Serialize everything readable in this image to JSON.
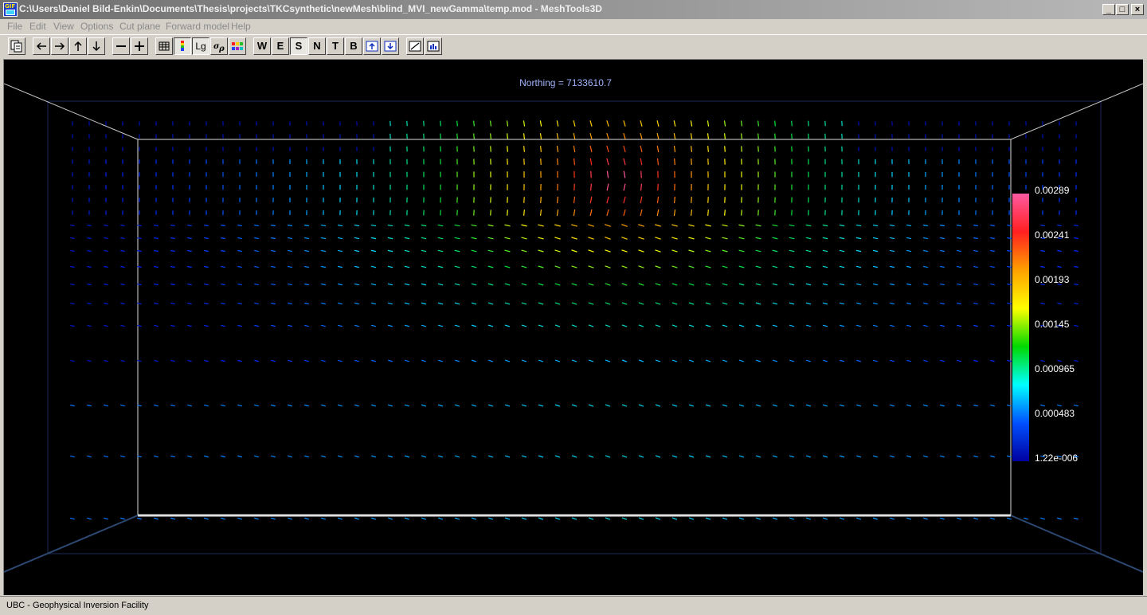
{
  "window": {
    "title": "C:\\Users\\Daniel Bild-Enkin\\Documents\\Thesis\\projects\\TKCsynthetic\\newMesh\\blind_MVI_newGamma\\temp.mod - MeshTools3D",
    "icon": "gif-app-icon",
    "controls": [
      "minimize",
      "maximize",
      "close"
    ]
  },
  "menu": [
    "File",
    "Edit",
    "View",
    "Options",
    "Cut plane",
    "Forward model",
    "Help"
  ],
  "toolbar": {
    "letters": [
      "W",
      "E",
      "S",
      "N",
      "T",
      "B"
    ],
    "pressed": "S",
    "log_label": "Lg"
  },
  "view": {
    "northing_label": "Northing =",
    "northing_value": "7133610.7"
  },
  "colorbar": {
    "labels": [
      "0.00289",
      "0.00241",
      "0.00193",
      "0.00145",
      "0.000965",
      "0.000483",
      "1.22e-006"
    ],
    "max": 0.00289,
    "min": 1.22e-06,
    "colors": [
      "#ff5aa0",
      "#ff2020",
      "#ffa000",
      "#ffff00",
      "#00d800",
      "#00ffff",
      "#0050ff",
      "#0000a0"
    ]
  },
  "status": {
    "text": "UBC - Geophysical Inversion Facility"
  }
}
